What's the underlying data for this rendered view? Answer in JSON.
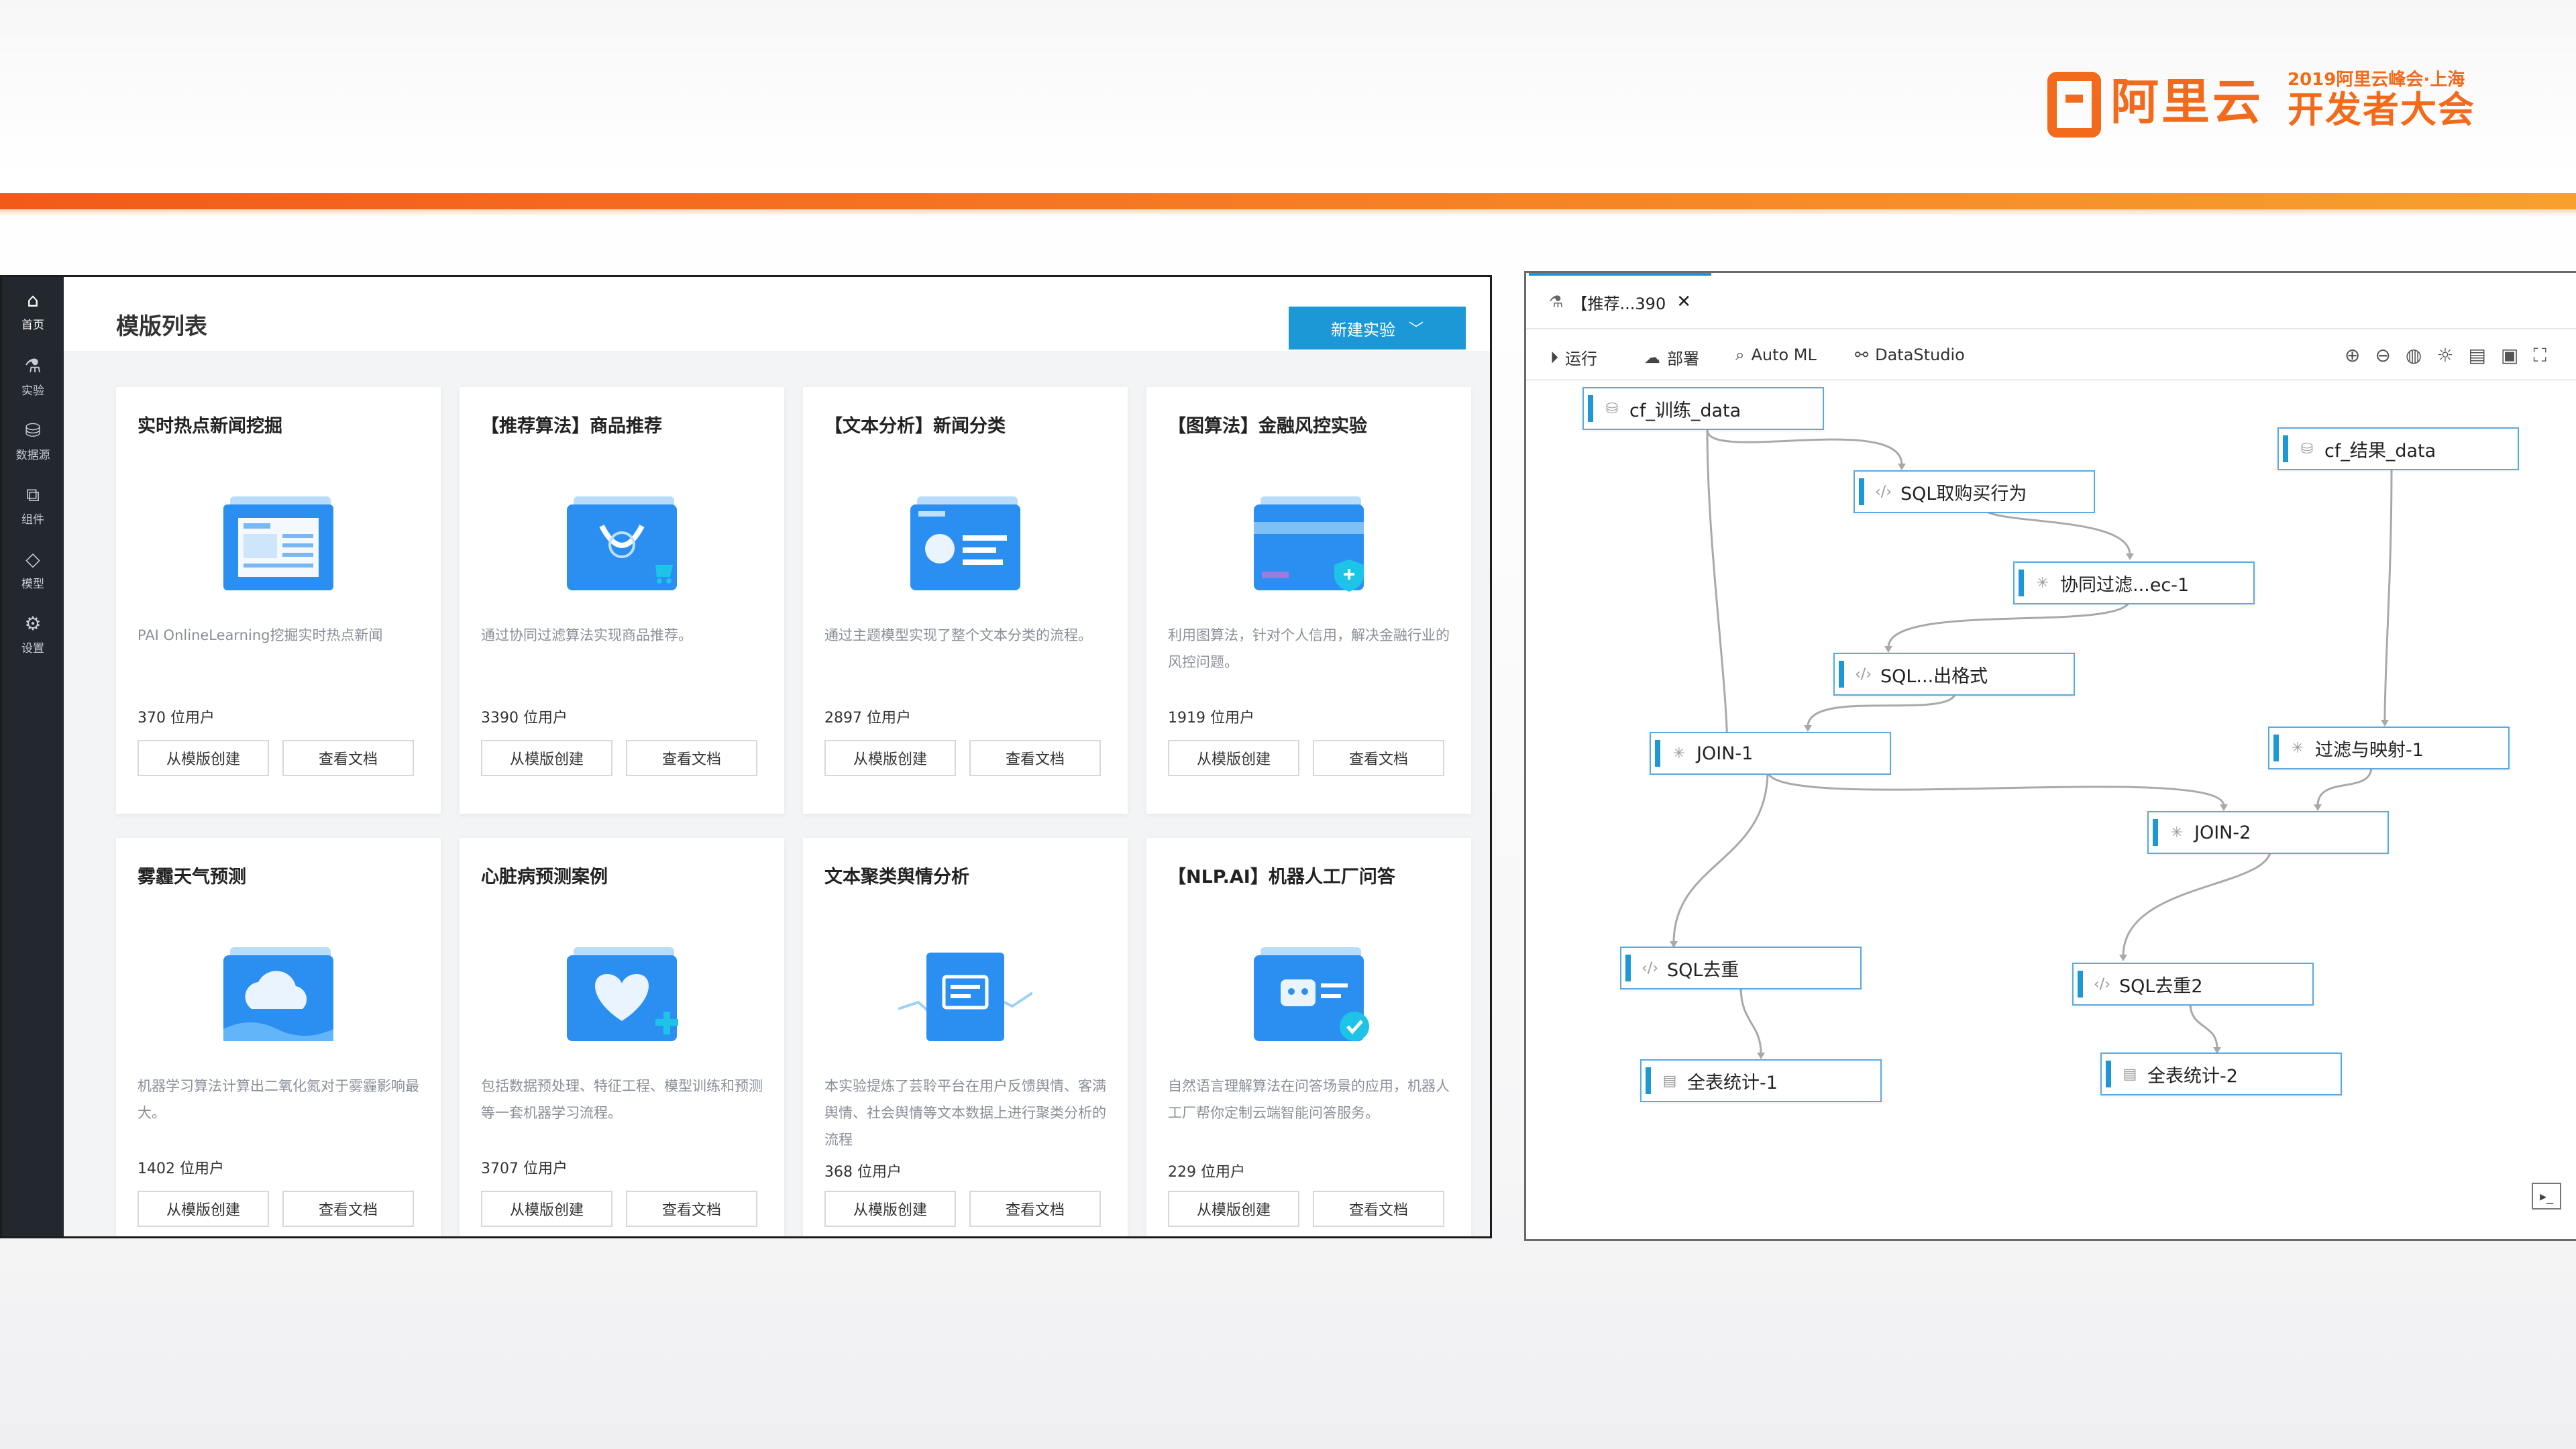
{
  "brand": {
    "name": "阿里云",
    "event_line1": "2019阿里云峰会·上海",
    "event_line2": "开发者大会"
  },
  "colors": {
    "accent": "#1c98d6",
    "brand_orange": "#f26a1b",
    "sidebar": "#23272e"
  },
  "sidebar": {
    "items": [
      {
        "label": "首页",
        "icon": "home-icon"
      },
      {
        "label": "实验",
        "icon": "flask-icon"
      },
      {
        "label": "数据源",
        "icon": "database-icon"
      },
      {
        "label": "组件",
        "icon": "puzzle-icon"
      },
      {
        "label": "模型",
        "icon": "diamond-icon"
      },
      {
        "label": "设置",
        "icon": "gear-icon"
      }
    ]
  },
  "main": {
    "title": "模版列表",
    "new_experiment": "新建实验",
    "cards": [
      {
        "title": "实时热点新闻挖掘",
        "icon": "news-icon",
        "desc": "PAI OnlineLearning挖掘实时热点新闻",
        "users": "370  位用户",
        "btn_create": "从模版创建",
        "btn_docs": "查看文档"
      },
      {
        "title": "【推荐算法】商品推荐",
        "icon": "shopping-bag-icon",
        "desc": "通过协同过滤算法实现商品推荐。",
        "users": "3390  位用户",
        "btn_create": "从模版创建",
        "btn_docs": "查看文档"
      },
      {
        "title": "【文本分析】新闻分类",
        "icon": "news-classify-icon",
        "desc": "通过主题模型实现了整个文本分类的流程。",
        "users": "2897  位用户",
        "btn_create": "从模版创建",
        "btn_docs": "查看文档"
      },
      {
        "title": "【图算法】金融风控实验",
        "icon": "risk-card-icon",
        "desc": "利用图算法，针对个人信用，解决金融行业的风控问题。",
        "users": "1919  位用户",
        "btn_create": "从模版创建",
        "btn_docs": "查看文档"
      },
      {
        "title": "雾霾天气预测",
        "icon": "pm25-cloud-icon",
        "desc": "机器学习算法计算出二氧化氮对于雾霾影响最大。",
        "users": "1402  位用户",
        "btn_create": "从模版创建",
        "btn_docs": "查看文档"
      },
      {
        "title": "心脏病预测案例",
        "icon": "heart-icon",
        "desc": "包括数据预处理、特征工程、模型训练和预测等一套机器学习流程。",
        "users": "3707  位用户",
        "btn_create": "从模版创建",
        "btn_docs": "查看文档"
      },
      {
        "title": "文本聚类舆情分析",
        "icon": "document-chart-icon",
        "desc": "本实验提炼了芸聆平台在用户反馈舆情、客满舆情、社会舆情等文本数据上进行聚类分析的流程",
        "users": "368  位用户",
        "btn_create": "从模版创建",
        "btn_docs": "查看文档"
      },
      {
        "title": "【NLP.AI】机器人工厂问答",
        "icon": "robot-icon",
        "desc": "自然语言理解算法在问答场景的应用，机器人工厂帮你定制云端智能问答服务。",
        "users": "229  位用户",
        "btn_create": "从模版创建",
        "btn_docs": "查看文档"
      }
    ]
  },
  "workflow": {
    "tab_label": "【推荐...390",
    "toolbar": {
      "run": "运行",
      "deploy": "部署",
      "automl": "Auto ML",
      "datastudio": "DataStudio"
    },
    "nodes": [
      {
        "id": "cf_train",
        "label": "cf_训练_data",
        "icon": "database-icon"
      },
      {
        "id": "cf_result",
        "label": "cf_结果_data",
        "icon": "database-icon"
      },
      {
        "id": "sql_buy",
        "label": "SQL取购买行为",
        "icon": "code-icon"
      },
      {
        "id": "cf_filter",
        "label": "协同过滤...ec-1",
        "icon": "spinner-icon"
      },
      {
        "id": "sql_format",
        "label": "SQL...出格式",
        "icon": "code-icon"
      },
      {
        "id": "join1",
        "label": "JOIN-1",
        "icon": "spinner-icon"
      },
      {
        "id": "filter_map",
        "label": "过滤与映射-1",
        "icon": "spinner-icon"
      },
      {
        "id": "join2",
        "label": "JOIN-2",
        "icon": "spinner-icon"
      },
      {
        "id": "sql_dedup",
        "label": "SQL去重",
        "icon": "code-icon"
      },
      {
        "id": "sql_dedup2",
        "label": "SQL去重2",
        "icon": "code-icon"
      },
      {
        "id": "stats1",
        "label": "全表统计-1",
        "icon": "report-icon"
      },
      {
        "id": "stats2",
        "label": "全表统计-2",
        "icon": "report-icon"
      }
    ]
  }
}
